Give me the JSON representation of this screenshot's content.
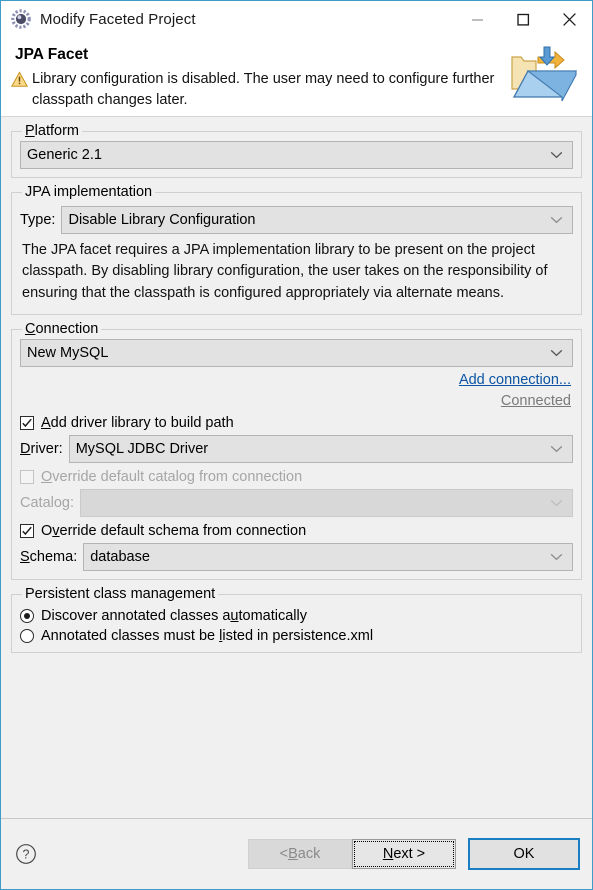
{
  "window": {
    "title": "Modify Faceted Project",
    "icon": "project-facets-icon",
    "controls": [
      {
        "name": "minimize-button",
        "glyph": "minimize-icon"
      },
      {
        "name": "maximize-button",
        "glyph": "maximize-icon"
      },
      {
        "name": "close-button",
        "glyph": "close-icon"
      }
    ]
  },
  "header": {
    "title": "JPA Facet",
    "warning_icon": "warning-triangle-icon",
    "message": "Library configuration is disabled. The user may need to configure further classpath changes later.",
    "banner_icon": "faceted-project-banner-icon"
  },
  "platform": {
    "legend_prefix": "P",
    "legend_rest": "latform",
    "value": "Generic 2.1"
  },
  "jpa_implementation": {
    "legend": "JPA implementation",
    "type_label": "Type:",
    "type_value": "Disable Library Configuration",
    "description": "The JPA facet requires a JPA implementation library to be present on the project classpath. By disabling library configuration, the user takes on the responsibility of ensuring that the classpath is configured appropriately via alternate means."
  },
  "connection": {
    "legend_prefix": "C",
    "legend_rest": "onnection",
    "value": "New MySQL",
    "add_connection_link": "Add connection...",
    "status_link": "Connected",
    "add_driver_checkbox": {
      "checked": true,
      "label_prefix": "",
      "label_accel": "A",
      "label_rest": "dd driver library to build path"
    },
    "driver_label_accel": "D",
    "driver_label_rest": "river:",
    "driver_value": "MySQL JDBC Driver",
    "override_catalog_checkbox": {
      "checked": false,
      "disabled": true,
      "label_prefix": "",
      "label_accel": "O",
      "label_rest": "verride default catalog from connection"
    },
    "catalog_label": "Catalog:",
    "catalog_value": "",
    "catalog_disabled": true,
    "override_schema_checkbox": {
      "checked": true,
      "disabled": false,
      "label_prefix": "O",
      "label_accel": "v",
      "label_rest": "erride default schema from connection"
    },
    "schema_label_accel": "S",
    "schema_label_rest": "chema:",
    "schema_value": "database"
  },
  "persistent_class_management": {
    "legend": "Persistent class management",
    "options": [
      {
        "label_prefix": "Discover annotated classes a",
        "label_accel": "u",
        "label_rest": "tomatically",
        "selected": true
      },
      {
        "label_prefix": "Annotated classes must be ",
        "label_accel": "l",
        "label_rest": "isted in persistence.xml",
        "selected": false
      }
    ]
  },
  "footer": {
    "help_icon": "help-question-icon",
    "buttons": [
      {
        "name": "back-button",
        "label_prefix": "< ",
        "label_accel": "B",
        "label_rest": "ack",
        "state": "disabled"
      },
      {
        "name": "next-button",
        "label_prefix": "",
        "label_accel": "N",
        "label_rest": "ext >",
        "state": "focused"
      },
      {
        "name": "ok-button",
        "label_prefix": "OK",
        "label_accel": "",
        "label_rest": "",
        "state": "default"
      }
    ]
  },
  "colors": {
    "window_border": "#3f9cc9",
    "dialog_bg": "#f0f0f0",
    "link": "#0b55a2",
    "muted_link": "#7a7a7a",
    "primary_button_border": "#1a7ec2",
    "warning": "#e8b33a"
  }
}
